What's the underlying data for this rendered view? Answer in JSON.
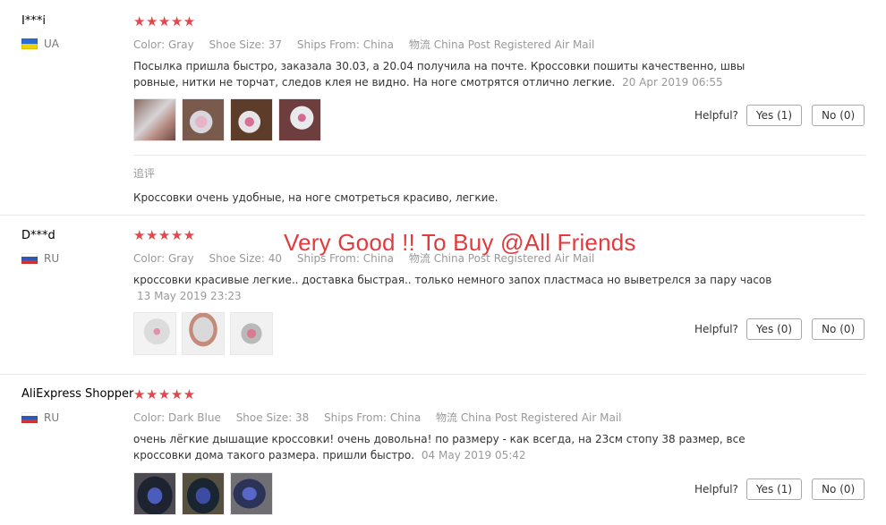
{
  "labels": {
    "color": "Color:",
    "shoe_size": "Shoe Size:",
    "ships_from": "Ships From:",
    "shipping_method": "物流",
    "helpful": "Helpful?"
  },
  "reviews": [
    {
      "user": "I***i",
      "country": "UA",
      "stars": "★★★★★",
      "color": "Gray",
      "shoe_size": "37",
      "ships_from": "China",
      "shipping": "China Post Registered Air Mail",
      "text_line1": "Посылка пришла быстро, заказала 30.03, а 20.04 получила на почте. Кроссовки пошиты качественно, швы",
      "text_line2": "ровные, нитки не торчат, следов клея не видно. На ноге смотрятся отлично легкие.",
      "date": "20 Apr 2019 06:55",
      "yes": "Yes (1)",
      "no": "No (0)",
      "followup_title": "追评",
      "followup_text": "Кроссовки очень удобные, на ноге смотреться красиво, легкие."
    },
    {
      "user": "D***d",
      "country": "RU",
      "stars": "★★★★★",
      "color": "Gray",
      "shoe_size": "40",
      "ships_from": "China",
      "shipping": "China Post Registered Air Mail",
      "text_line1": "кроссовки красивые легкие.. доставка быстрая.. только немного запох пластмаса но выветрелся за пару часов",
      "date": "13 May 2019 23:23",
      "yes": "Yes (0)",
      "no": "No (0)"
    },
    {
      "user": "AliExpress Shopper",
      "country": "RU",
      "stars": "★★★★★",
      "color": "Dark Blue",
      "shoe_size": "38",
      "ships_from": "China",
      "shipping": "China Post Registered Air Mail",
      "text_line1": "очень лёгкие дышащие кроссовки! очень довольна! по размеру - как всегда, на 23см стопу 38 размер, все",
      "text_line2": "кроссовки дома такого размера. пришли быстро.",
      "date": "04 May 2019 05:42",
      "yes": "Yes (1)",
      "no": "No (0)"
    }
  ],
  "overlay_text": "Very Good !! To Buy @All Friends",
  "colors": {
    "star": "#e5454b",
    "overlay": "#e43a3e",
    "muted": "#999999"
  }
}
